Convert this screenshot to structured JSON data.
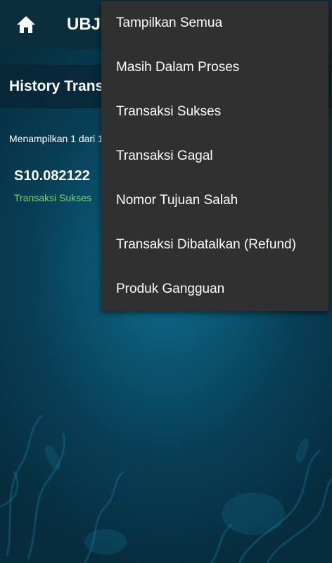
{
  "app": {
    "title": "UBJ",
    "home_icon": "home-icon"
  },
  "section": {
    "title": "History Transaksi"
  },
  "list": {
    "count_text": "Menampilkan 1 dari 1 data",
    "items": [
      {
        "id": "S10.082122",
        "status": "Transaksi Sukses",
        "status_color": "#7fd36a"
      }
    ]
  },
  "filter_menu": {
    "items": [
      {
        "label": "Tampilkan Semua"
      },
      {
        "label": "Masih Dalam Proses"
      },
      {
        "label": "Transaksi Sukses"
      },
      {
        "label": "Transaksi Gagal"
      },
      {
        "label": "Nomor Tujuan Salah"
      },
      {
        "label": "Transaksi Dibatalkan (Refund)"
      },
      {
        "label": "Produk Gangguan"
      }
    ]
  },
  "colors": {
    "topbar": "#0b2e3d",
    "menu_bg": "#303030",
    "background": "#0a5571"
  }
}
